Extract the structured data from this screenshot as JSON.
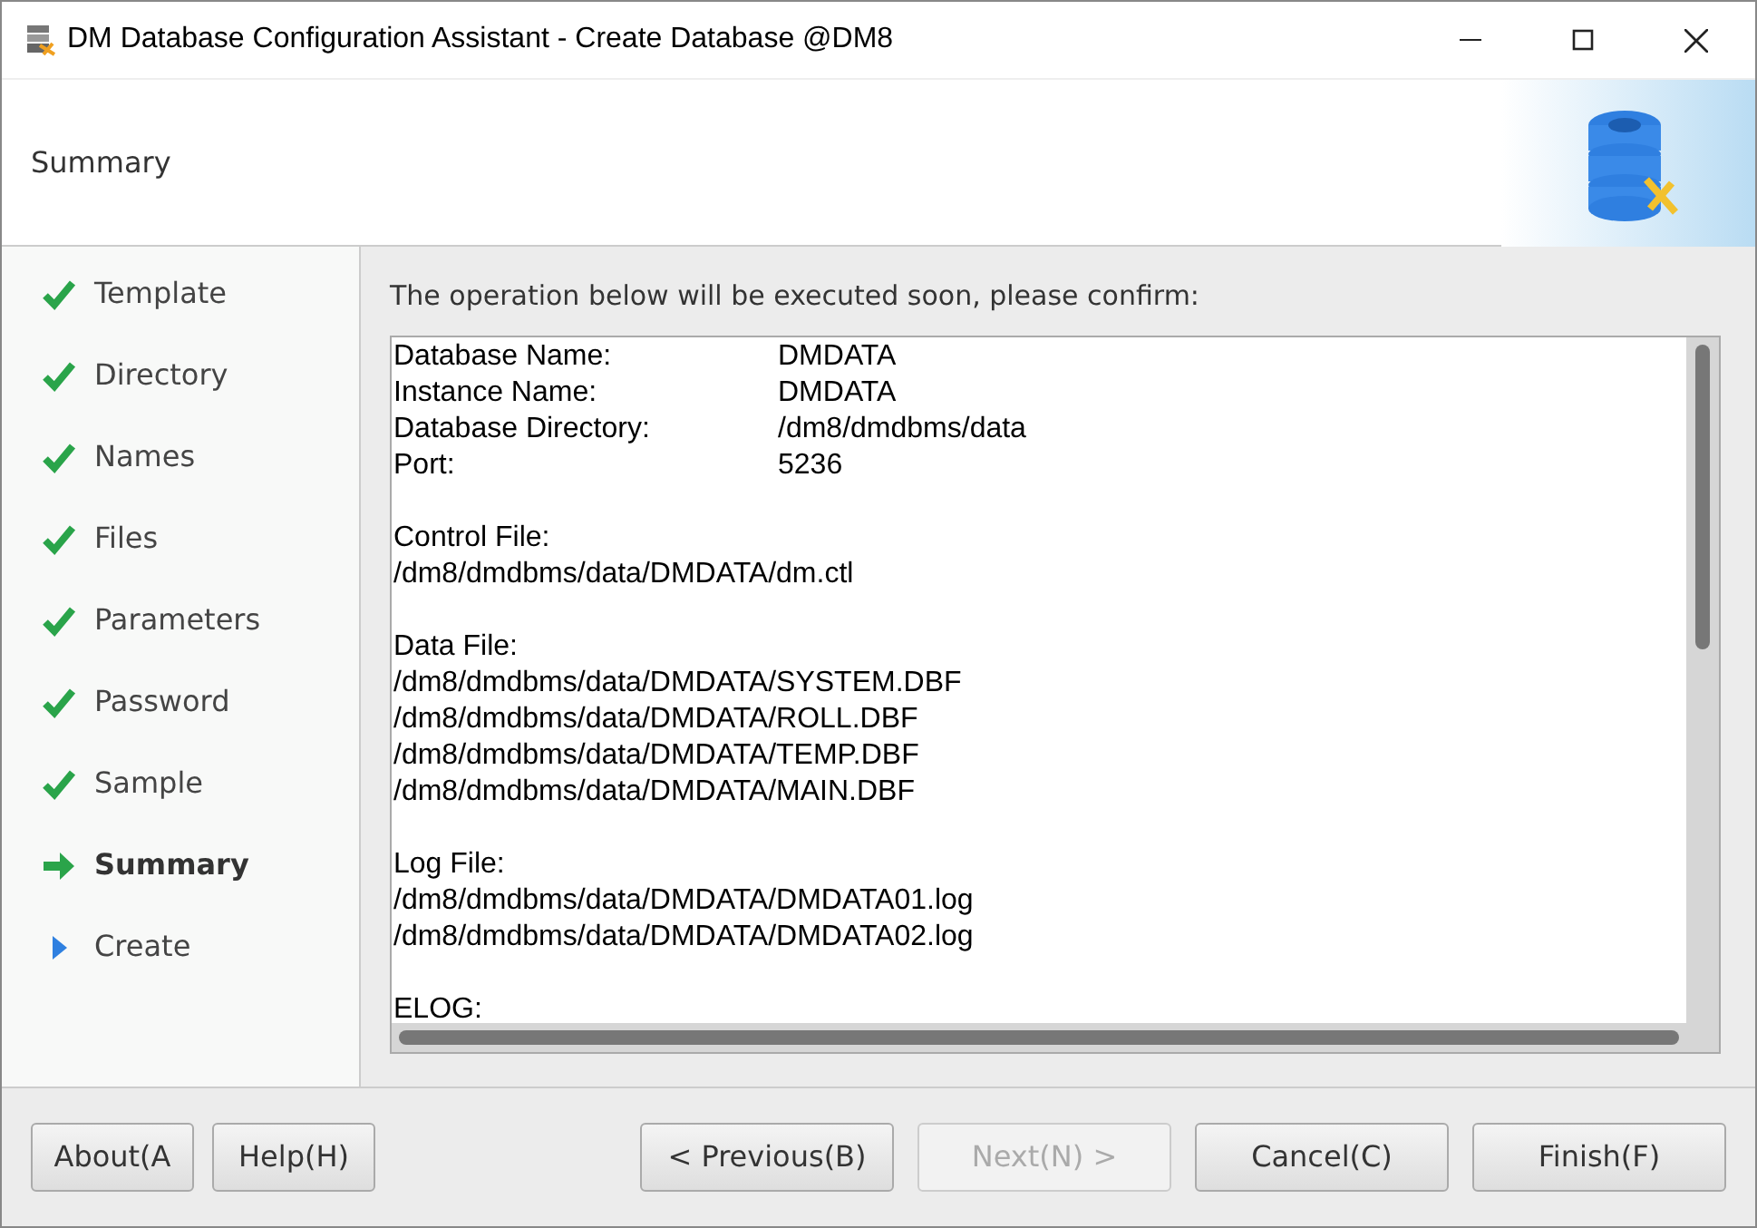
{
  "window": {
    "title": "DM Database Configuration Assistant - Create Database @DM8"
  },
  "header": {
    "title": "Summary"
  },
  "steps": [
    {
      "label": "Template",
      "kind": "done"
    },
    {
      "label": "Directory",
      "kind": "done"
    },
    {
      "label": "Names",
      "kind": "done"
    },
    {
      "label": "Files",
      "kind": "done"
    },
    {
      "label": "Parameters",
      "kind": "done"
    },
    {
      "label": "Password",
      "kind": "done"
    },
    {
      "label": "Sample",
      "kind": "done"
    },
    {
      "label": "Summary",
      "kind": "current"
    },
    {
      "label": "Create",
      "kind": "pending"
    }
  ],
  "prompt": "The operation below will be executed soon, please confirm:",
  "summary": [
    {
      "lines": [
        {
          "label": "Database Name:",
          "value": "DMDATA"
        },
        {
          "label": "Instance Name:",
          "value": "DMDATA"
        },
        {
          "label": "Database Directory:",
          "value": "/dm8/dmdbms/data"
        },
        {
          "label": "Port:",
          "value": "5236"
        }
      ]
    },
    {
      "lines": [
        {
          "label": "Control File:"
        },
        {
          "label": "/dm8/dmdbms/data/DMDATA/dm.ctl"
        }
      ]
    },
    {
      "lines": [
        {
          "label": "Data File:"
        },
        {
          "label": "/dm8/dmdbms/data/DMDATA/SYSTEM.DBF"
        },
        {
          "label": "/dm8/dmdbms/data/DMDATA/ROLL.DBF"
        },
        {
          "label": "/dm8/dmdbms/data/DMDATA/TEMP.DBF"
        },
        {
          "label": "/dm8/dmdbms/data/DMDATA/MAIN.DBF"
        }
      ]
    },
    {
      "lines": [
        {
          "label": "Log File:"
        },
        {
          "label": "/dm8/dmdbms/data/DMDATA/DMDATA01.log"
        },
        {
          "label": "/dm8/dmdbms/data/DMDATA/DMDATA02.log"
        }
      ]
    },
    {
      "lines": [
        {
          "label": "ELOG:"
        }
      ]
    }
  ],
  "left_buttons": [
    {
      "label": "About(A",
      "disabled": false
    },
    {
      "label": "Help(H)",
      "disabled": false
    }
  ],
  "nav_buttons": [
    {
      "label": "< Previous(B)",
      "disabled": false
    },
    {
      "label": "Next(N) >",
      "disabled": true
    },
    {
      "label": "Cancel(C)",
      "disabled": false
    },
    {
      "label": "Finish(F)",
      "disabled": false
    }
  ]
}
